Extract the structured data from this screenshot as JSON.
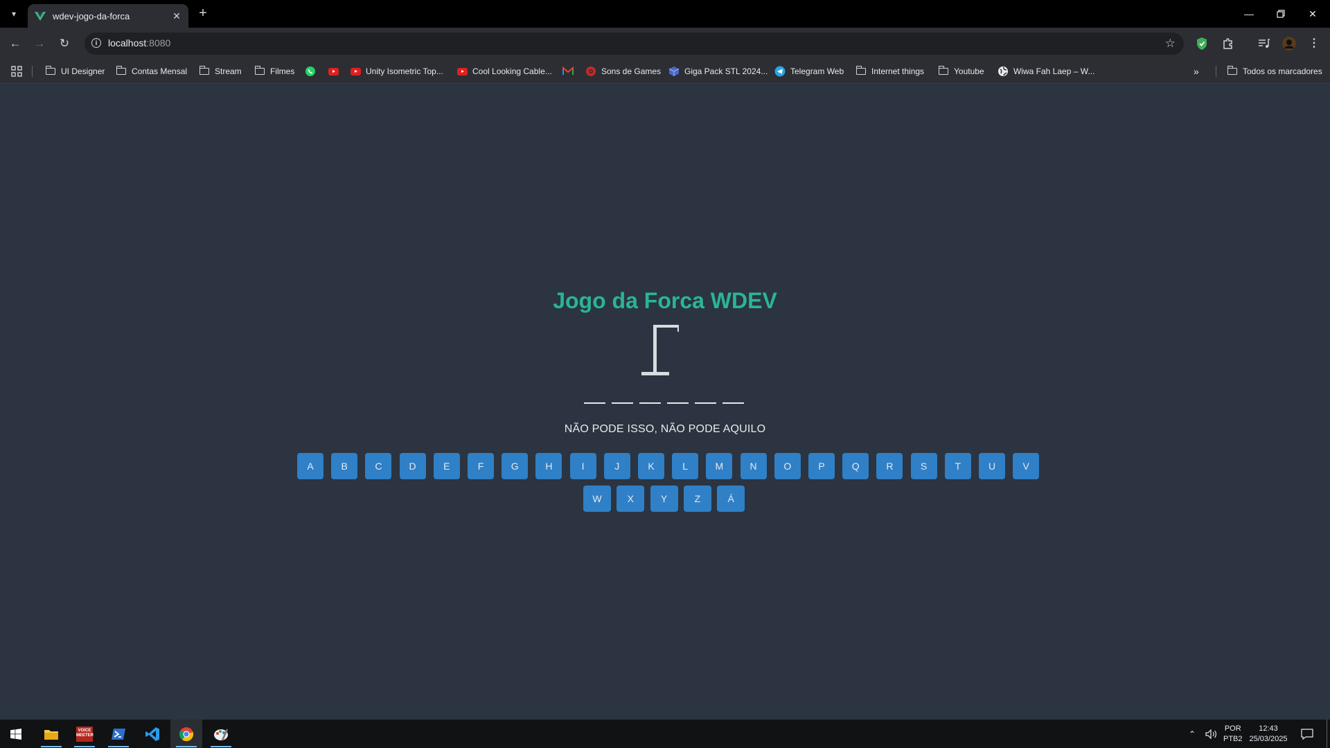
{
  "browser": {
    "tab_title": "wdev-jogo-da-forca",
    "url_host": "localhost",
    "url_port": ":8080"
  },
  "bookmarks": [
    {
      "label": "UI Designer",
      "icon": "folder-icon"
    },
    {
      "label": "Contas Mensal",
      "icon": "folder-icon"
    },
    {
      "label": "Stream",
      "icon": "folder-icon"
    },
    {
      "label": "Filmes",
      "icon": "folder-icon"
    },
    {
      "label": "",
      "icon": "whatsapp-icon"
    },
    {
      "label": "",
      "icon": "youtube-icon"
    },
    {
      "label": "Unity Isometric Top...",
      "icon": "youtube-icon"
    },
    {
      "label": "Cool Looking Cable...",
      "icon": "youtube-icon"
    },
    {
      "label": "",
      "icon": "gmail-icon"
    },
    {
      "label": "Sons de Games",
      "icon": "sound-icon"
    },
    {
      "label": "Giga Pack STL 2024...",
      "icon": "cube-icon"
    },
    {
      "label": "Telegram Web",
      "icon": "telegram-icon"
    },
    {
      "label": "Internet things",
      "icon": "folder-icon"
    },
    {
      "label": "Youtube",
      "icon": "folder-icon"
    },
    {
      "label": "Wiwa Fah Laep – W...",
      "icon": "globe-icon"
    }
  ],
  "all_bookmarks_label": "Todos os marcadores",
  "game": {
    "title": "Jogo da Forca WDEV",
    "word_length": 6,
    "hint": "NÃO PODE ISSO, NÃO PODE AQUILO",
    "keys_row1": [
      "A",
      "B",
      "C",
      "D",
      "E",
      "F",
      "G",
      "H",
      "I",
      "J",
      "K",
      "L",
      "M",
      "N",
      "O",
      "P",
      "Q",
      "R",
      "S",
      "T",
      "U",
      "V"
    ],
    "keys_row2": [
      "W",
      "X",
      "Y",
      "Z",
      "Á"
    ]
  },
  "taskbar": {
    "apps": [
      "file-explorer-icon",
      "voicemeeter-icon",
      "powershell-icon",
      "vscode-icon",
      "chrome-icon",
      "paint-icon"
    ],
    "voicemeeter_text": "VOICE MEETER",
    "lang_top": "POR",
    "lang_bottom": "PTB2",
    "time": "12:43",
    "date": "25/03/2025"
  },
  "colors": {
    "background": "#2b3440",
    "title": "#2ab595",
    "key": "#2f80c7"
  }
}
